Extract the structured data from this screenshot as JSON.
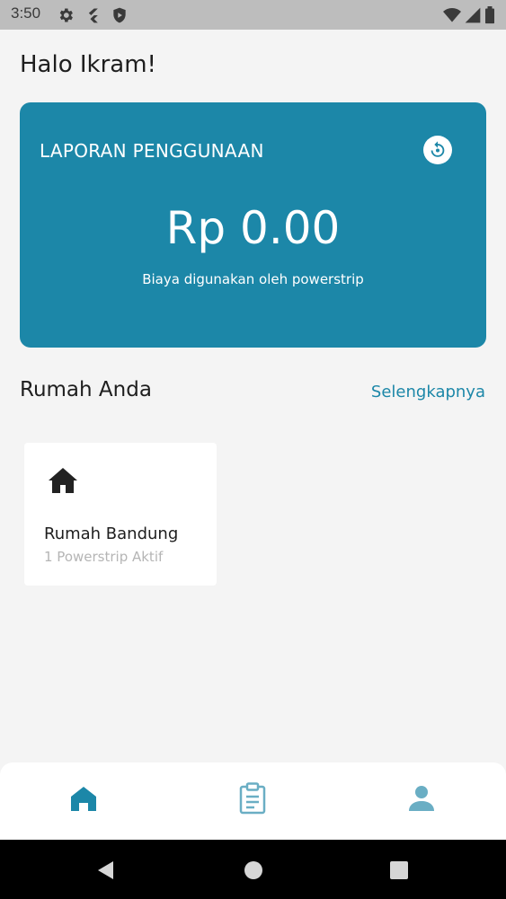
{
  "status_bar": {
    "time": "3:50",
    "left_icons": [
      "gear-icon",
      "flutter-icon",
      "shield-icon"
    ],
    "right_icons": [
      "wifi-icon",
      "signal-icon",
      "battery-icon"
    ]
  },
  "greeting": "Halo Ikram!",
  "usage_card": {
    "title": "LAPORAN PENGGUNAAN",
    "amount": "Rp 0.00",
    "caption": "Biaya digunakan oleh powerstrip",
    "background": "#1c87a8",
    "refresh_icon": "refresh-icon"
  },
  "homes_section": {
    "title": "Rumah Anda",
    "more_link": "Selengkapnya",
    "items": [
      {
        "name": "Rumah Bandung",
        "subtitle": "1 Powerstrip Aktif",
        "icon": "house-icon"
      }
    ]
  },
  "bottom_nav": {
    "items": [
      {
        "icon": "home-icon",
        "active": true
      },
      {
        "icon": "clipboard-icon",
        "active": false
      },
      {
        "icon": "person-icon",
        "active": false
      }
    ],
    "active_color": "#1c87a8",
    "inactive_color": "#6aaec4"
  },
  "system_nav": [
    "back-icon",
    "home-circle-icon",
    "recents-icon"
  ]
}
